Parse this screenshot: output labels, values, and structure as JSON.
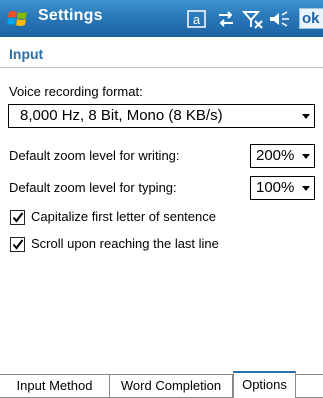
{
  "titlebar": {
    "title": "Settings",
    "ok_label": "ok",
    "icons": [
      "windows-logo-icon",
      "input-method-icon",
      "connectivity-icon",
      "signal-off-icon",
      "volume-icon"
    ]
  },
  "section": {
    "title": "Input"
  },
  "voice": {
    "label": "Voice recording format:",
    "value": "8,000 Hz, 8 Bit, Mono (8 KB/s)"
  },
  "zoom_writing": {
    "label": "Default zoom level for writing:",
    "value": "200%"
  },
  "zoom_typing": {
    "label": "Default zoom level for typing:",
    "value": "100%"
  },
  "checks": [
    {
      "label": "Capitalize first letter of sentence",
      "checked": true
    },
    {
      "label": "Scroll upon reaching the last line",
      "checked": true
    }
  ],
  "tabs": [
    {
      "label": "Input Method",
      "active": false
    },
    {
      "label": "Word Completion",
      "active": false
    },
    {
      "label": "Options",
      "active": true
    }
  ],
  "colors": {
    "titlebar": "#2a78b8",
    "accent": "#2b6fab"
  }
}
